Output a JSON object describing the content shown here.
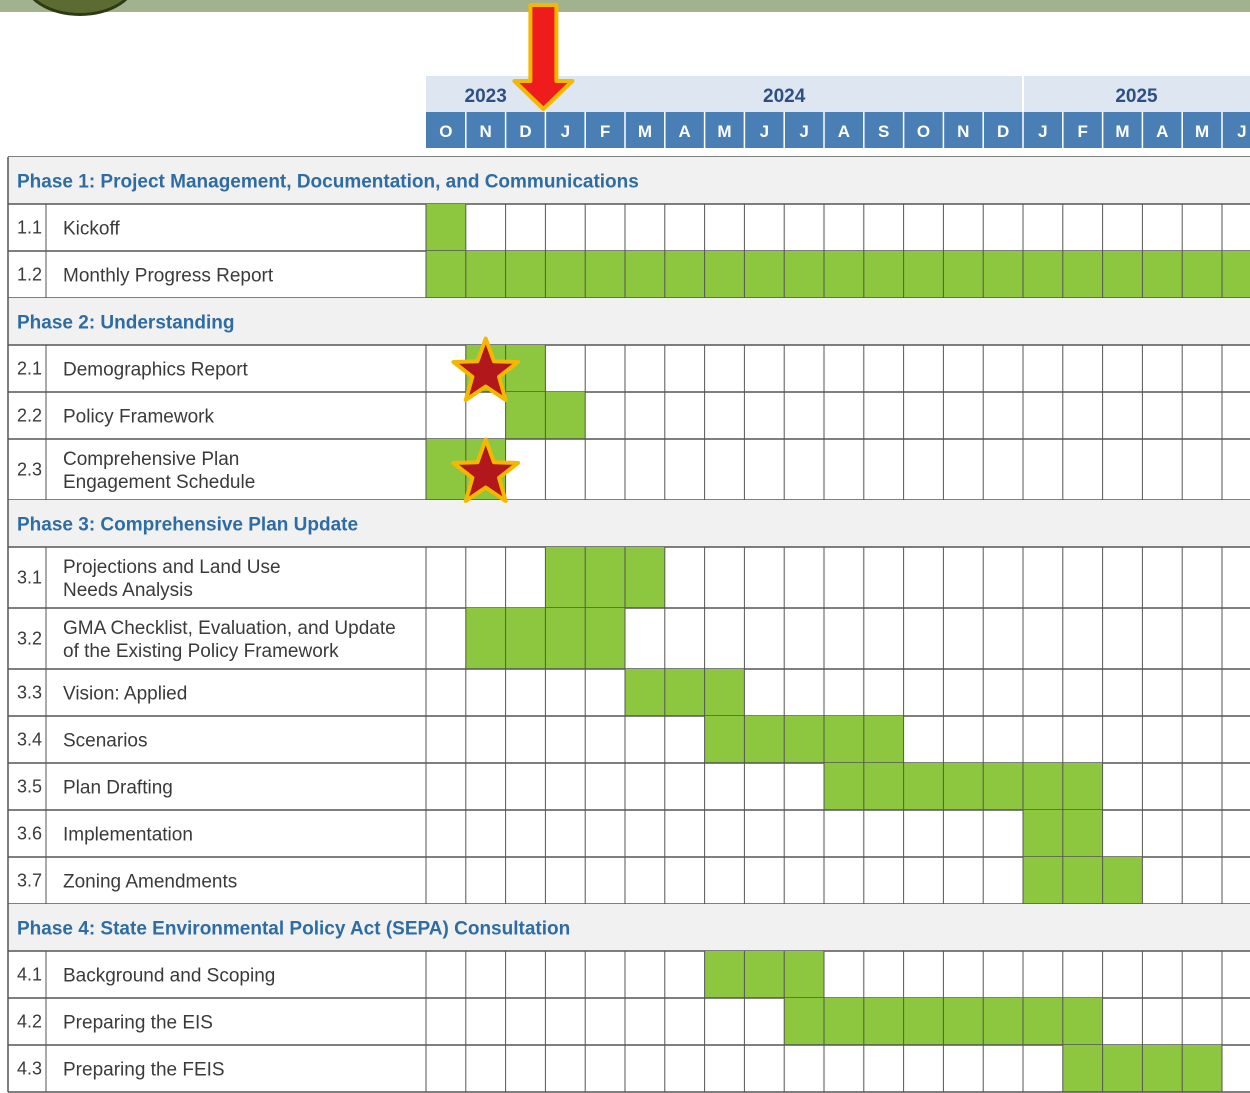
{
  "years": [
    {
      "label": "2023",
      "start": 0,
      "span": 3
    },
    {
      "label": "2024",
      "start": 3,
      "span": 12
    },
    {
      "label": "2025",
      "start": 15,
      "span": 6
    }
  ],
  "months": [
    "O",
    "N",
    "D",
    "J",
    "F",
    "M",
    "A",
    "M",
    "J",
    "J",
    "A",
    "S",
    "O",
    "N",
    "D",
    "J",
    "F",
    "M",
    "A",
    "M",
    "J"
  ],
  "rows": [
    {
      "type": "phase",
      "label": "Phase 1: Project Management, Documentation, and Communications"
    },
    {
      "type": "task",
      "num": "1.1",
      "label": [
        "Kickoff"
      ],
      "active": [
        0
      ]
    },
    {
      "type": "task",
      "num": "1.2",
      "label": [
        "Monthly Progress Report"
      ],
      "active": [
        0,
        1,
        2,
        3,
        4,
        5,
        6,
        7,
        8,
        9,
        10,
        11,
        12,
        13,
        14,
        15,
        16,
        17,
        18,
        19,
        20
      ]
    },
    {
      "type": "phase",
      "label": "Phase 2: Understanding"
    },
    {
      "type": "task",
      "num": "2.1",
      "label": [
        "Demographics Report"
      ],
      "active": [
        1,
        2
      ],
      "star": 1
    },
    {
      "type": "task",
      "num": "2.2",
      "label": [
        "Policy Framework"
      ],
      "active": [
        2,
        3
      ]
    },
    {
      "type": "task",
      "num": "2.3",
      "label": [
        "Comprehensive Plan",
        "Engagement Schedule"
      ],
      "active": [
        0,
        1
      ],
      "star": 1
    },
    {
      "type": "phase",
      "label": "Phase 3: Comprehensive Plan Update"
    },
    {
      "type": "task",
      "num": "3.1",
      "label": [
        "Projections and Land Use",
        "Needs Analysis"
      ],
      "active": [
        3,
        4,
        5
      ]
    },
    {
      "type": "task",
      "num": "3.2",
      "label": [
        "GMA Checklist, Evaluation, and Update",
        "of the Existing Policy Framework"
      ],
      "active": [
        1,
        2,
        3,
        4
      ]
    },
    {
      "type": "task",
      "num": "3.3",
      "label": [
        "Vision: Applied"
      ],
      "active": [
        5,
        6,
        7
      ]
    },
    {
      "type": "task",
      "num": "3.4",
      "label": [
        "Scenarios"
      ],
      "active": [
        7,
        8,
        9,
        10,
        11
      ]
    },
    {
      "type": "task",
      "num": "3.5",
      "label": [
        "Plan Drafting"
      ],
      "active": [
        10,
        11,
        12,
        13,
        14,
        15,
        16
      ]
    },
    {
      "type": "task",
      "num": "3.6",
      "label": [
        "Implementation"
      ],
      "active": [
        15,
        16
      ]
    },
    {
      "type": "task",
      "num": "3.7",
      "label": [
        "Zoning Amendments"
      ],
      "active": [
        15,
        16,
        17
      ]
    },
    {
      "type": "phase",
      "label": "Phase 4: State Environmental Policy Act (SEPA) Consultation"
    },
    {
      "type": "task",
      "num": "4.1",
      "label": [
        "Background and Scoping"
      ],
      "active": [
        7,
        8,
        9
      ]
    },
    {
      "type": "task",
      "num": "4.2",
      "label": [
        "Preparing the EIS"
      ],
      "active": [
        9,
        10,
        11,
        12,
        13,
        14,
        15,
        16
      ]
    },
    {
      "type": "task",
      "num": "4.3",
      "label": [
        "Preparing the FEIS"
      ],
      "active": [
        16,
        17,
        18,
        19
      ]
    }
  ],
  "marker": {
    "type": "down-arrow-icon",
    "month_index": 3
  },
  "colors": {
    "bar": "#8dc63f",
    "header": "#4a7fb5",
    "year_band": "#dde6f1",
    "phase_band": "#f1f1f1",
    "grid": "#555555",
    "star": "#b2181b",
    "star_outline": "#f5b800",
    "arrow": "#ee1c1c",
    "arrow_outline": "#f5b800"
  }
}
